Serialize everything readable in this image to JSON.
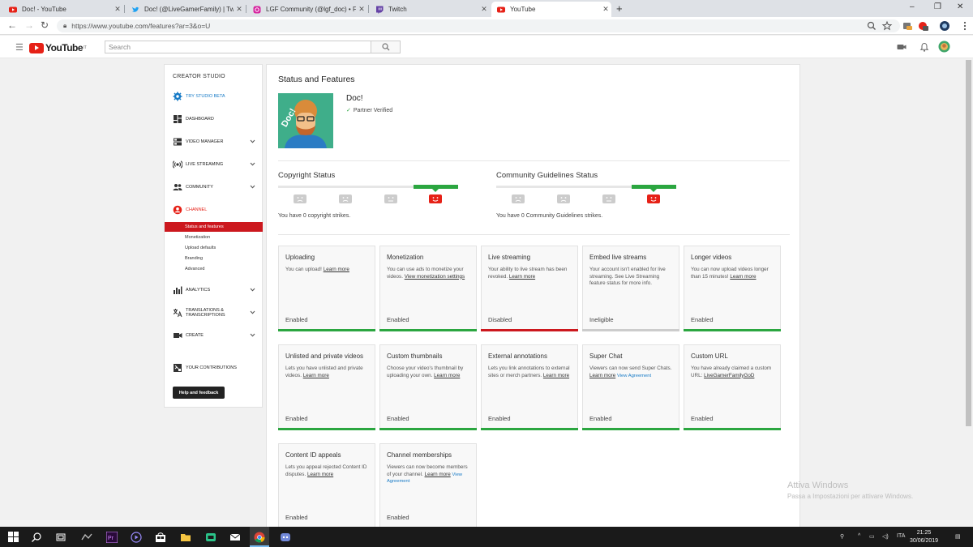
{
  "browser": {
    "tabs": [
      {
        "title": "Doc! - YouTube",
        "icon": "youtube-icon"
      },
      {
        "title": "Doc! (@LiveGamerFamily) | Twitte",
        "icon": "twitter-icon"
      },
      {
        "title": "LGF Community (@lgf_doc) • Foto",
        "icon": "instagram-icon"
      },
      {
        "title": "Twitch",
        "icon": "twitch-icon"
      },
      {
        "title": "YouTube",
        "icon": "youtube-icon",
        "active": true
      }
    ],
    "url": "https://www.youtube.com/features?ar=3&o=U",
    "new_tab": "+",
    "window_controls": [
      "–",
      "❐",
      "✕"
    ]
  },
  "youtube": {
    "logo_text": "YouTube",
    "logo_country": "IT",
    "search_placeholder": "Search"
  },
  "sidebar": {
    "title": "CREATOR STUDIO",
    "items": [
      {
        "label": "TRY STUDIO BETA",
        "icon": "gear-icon",
        "style": "blue"
      },
      {
        "label": "DASHBOARD",
        "icon": "dashboard-icon"
      },
      {
        "label": "VIDEO MANAGER",
        "icon": "video-manager-icon",
        "chevron": true
      },
      {
        "label": "LIVE STREAMING",
        "icon": "live-streaming-icon",
        "chevron": true
      },
      {
        "label": "COMMUNITY",
        "icon": "community-icon",
        "chevron": true
      },
      {
        "label": "CHANNEL",
        "icon": "channel-icon",
        "style": "red"
      }
    ],
    "subitems": [
      {
        "label": "Status and features",
        "active": true
      },
      {
        "label": "Monetization"
      },
      {
        "label": "Upload defaults"
      },
      {
        "label": "Branding"
      },
      {
        "label": "Advanced"
      }
    ],
    "items2": [
      {
        "label": "ANALYTICS",
        "icon": "analytics-icon",
        "chevron": true
      },
      {
        "label": "TRANSLATIONS & TRANSCRIPTIONS",
        "icon": "translate-icon",
        "chevron": true
      },
      {
        "label": "CREATE",
        "icon": "create-icon",
        "chevron": true
      },
      {
        "label": "YOUR CONTRIBUTIONS",
        "icon": "contributions-icon"
      }
    ],
    "help_button": "Help and feedback"
  },
  "main": {
    "title": "Status and Features",
    "channel_name": "Doc!",
    "partner_status": "Partner Verified",
    "copyright": {
      "heading": "Copyright Status",
      "text": "You have 0 copyright strikes."
    },
    "community": {
      "heading": "Community Guidelines Status",
      "text": "You have 0 Community Guidelines strikes."
    },
    "features": [
      {
        "title": "Uploading",
        "desc": "You can upload! ",
        "link": "Learn more",
        "status": "Enabled",
        "bar": "green"
      },
      {
        "title": "Monetization",
        "desc": "You can use ads to monetize your videos. ",
        "link": "View monetization settings",
        "status": "Enabled",
        "bar": "green"
      },
      {
        "title": "Live streaming",
        "desc": "Your ability to live stream has been revoked. ",
        "link": "Learn more",
        "status": "Disabled",
        "bar": "red"
      },
      {
        "title": "Embed live streams",
        "desc": "Your account isn't enabled for live streaming. See Live Streaming feature status for more info.",
        "link": "",
        "status": "Ineligible",
        "bar": "gray"
      },
      {
        "title": "Longer videos",
        "desc": "You can now upload videos longer than 15 minutes! ",
        "link": "Learn more",
        "status": "Enabled",
        "bar": "green"
      },
      {
        "title": "Unlisted and private videos",
        "desc": "Lets you have unlisted and private videos. ",
        "link": "Learn more",
        "status": "Enabled",
        "bar": "green"
      },
      {
        "title": "Custom thumbnails",
        "desc": "Choose your video's thumbnail by uploading your own. ",
        "link": "Learn more",
        "status": "Enabled",
        "bar": "green"
      },
      {
        "title": "External annotations",
        "desc": "Lets you link annotations to external sites or merch partners. ",
        "link": "Learn more",
        "status": "Enabled",
        "bar": "green"
      },
      {
        "title": "Super Chat",
        "desc": "Viewers can now send Super Chats. ",
        "link": "Learn more",
        "extra": "View Agreement",
        "status": "Enabled",
        "bar": "green"
      },
      {
        "title": "Custom URL",
        "desc": "You have already claimed a custom URL: ",
        "link": "LiveGamerFamilyGoD",
        "status": "Enabled",
        "bar": "green"
      },
      {
        "title": "Content ID appeals",
        "desc": "Lets you appeal rejected Content ID disputes. ",
        "link": "Learn more",
        "status": "Enabled",
        "bar": "green"
      },
      {
        "title": "Channel memberships",
        "desc": "Viewers can now become members of your channel. ",
        "link": "Learn more",
        "extra": "View Agreement",
        "status": "Enabled",
        "bar": "green"
      }
    ]
  },
  "watermark": {
    "line1": "Attiva Windows",
    "line2": "Passa a Impostazioni per attivare Windows."
  },
  "taskbar": {
    "language": "ITA",
    "time": "21:25",
    "date": "30/06/2019"
  }
}
